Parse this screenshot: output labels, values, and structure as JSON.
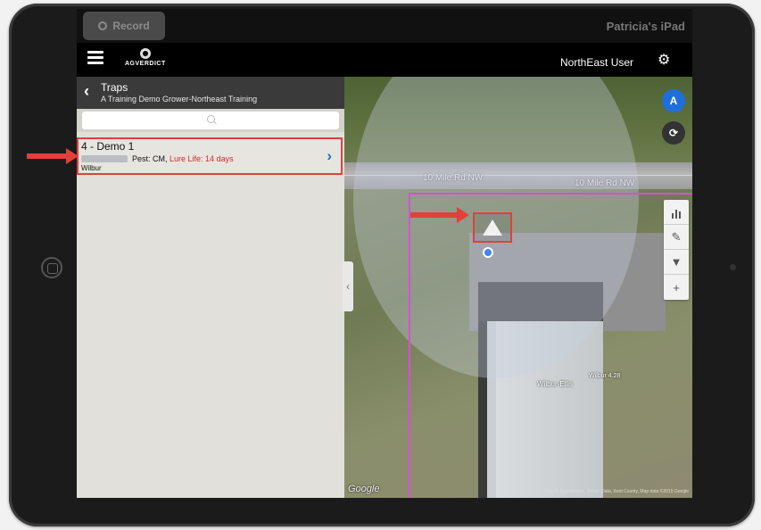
{
  "status_bar": {
    "record_label": "Record",
    "device_name": "Patricia's iPad"
  },
  "app_bar": {
    "logo_text": "AGVERDICT",
    "user_name": "NorthEast User"
  },
  "panel": {
    "title": "Traps",
    "subtitle": "A Training Demo Grower-Northeast Training",
    "search_placeholder": ""
  },
  "trap": {
    "name": "4 - Demo 1",
    "pest": "Pest: CM,",
    "lure": "Lure Life: 14 days",
    "grower": "Wilbur"
  },
  "map": {
    "road_label_left": "10 Mile Rd NW",
    "road_label_right": "10 Mile Rd NW",
    "poi_name": "Wilbur-Ellis",
    "poi_detail": "Wilbur\n4.28",
    "google_mark": "Google",
    "attribution": "©2015 DigitalGlobe, Terrain Data, Kent County, Map data ©2015 Google",
    "fab_nav_label": "A"
  },
  "icons": {
    "menu": "hamburger-menu-icon",
    "settings": "gear-icon",
    "back": "chevron-left-icon",
    "search": "search-icon",
    "next": "chevron-right-icon",
    "collapse": "chevron-left-icon",
    "refresh": "refresh-icon",
    "chart": "bar-chart-icon",
    "edit": "edit-icon",
    "filter": "filter-icon",
    "add": "plus-icon"
  },
  "colors": {
    "highlight_red": "#e0413a",
    "lure_red": "#cc2b2b",
    "accent_blue": "#1f6fd8",
    "geofence_magenta": "#d74fd6"
  }
}
